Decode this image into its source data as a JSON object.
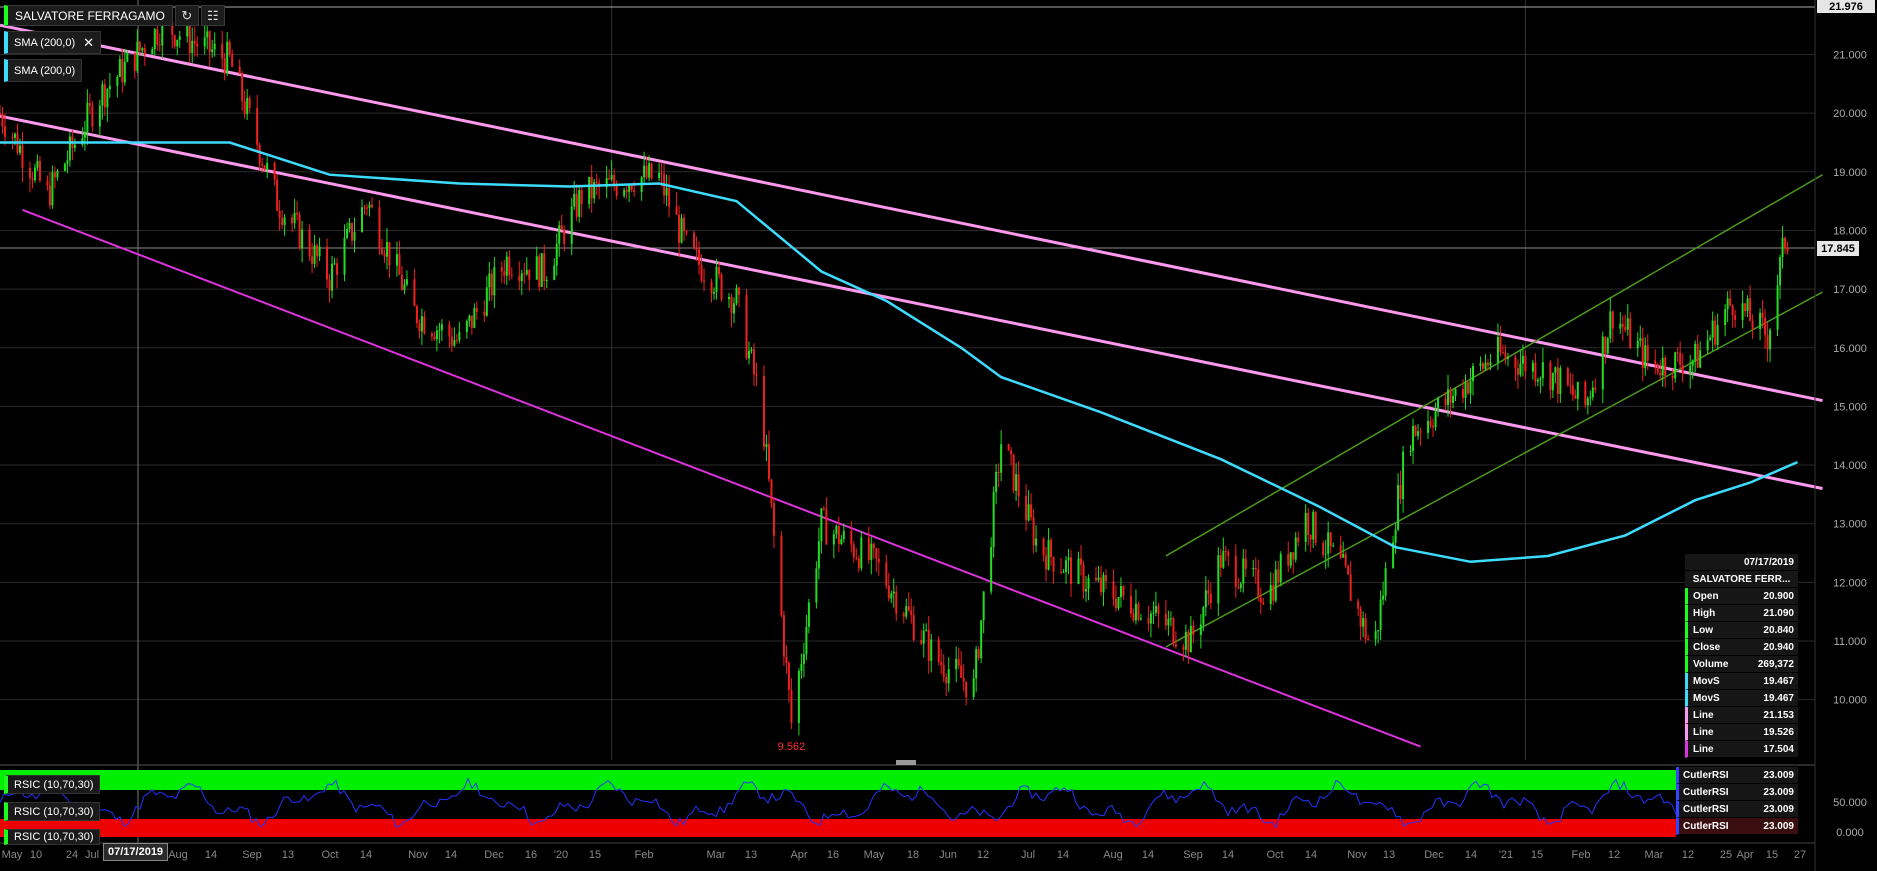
{
  "header": {
    "symbol": "SALVATORE FERRAGAMO",
    "refresh_icon": "refresh-icon",
    "settings_icon": "chart-settings-icon"
  },
  "indicators": [
    {
      "label": "SMA (200,0)",
      "color": "#3ddcff",
      "closable": true
    },
    {
      "label": "SMA (200,0)",
      "color": "#3ddcff",
      "closable": false
    }
  ],
  "rsi_labels": [
    "RSIC (10,70,30)",
    "RSIC (10,70,30)",
    "RSIC (10,70,30)"
  ],
  "price_axis": {
    "ticks": [
      "21.000",
      "20.000",
      "19.000",
      "18.000",
      "17.000",
      "16.000",
      "15.000",
      "14.000",
      "13.000",
      "12.000",
      "11.000",
      "10.000"
    ],
    "top_label": "21.976",
    "current_label": "17.845"
  },
  "rsi_axis": {
    "ticks": [
      "50.000",
      "0.000"
    ]
  },
  "low_marker": "9.562",
  "date_axis": {
    "labels": [
      "May",
      "10",
      "24",
      "Jul",
      "Aug",
      "14",
      "Sep",
      "13",
      "Oct",
      "14",
      "Nov",
      "14",
      "Dec",
      "16",
      "'20",
      "15",
      "Feb",
      "Mar",
      "13",
      "Apr",
      "16",
      "May",
      "18",
      "Jun",
      "12",
      "Jul",
      "14",
      "Aug",
      "14",
      "Sep",
      "14",
      "Oct",
      "14",
      "Nov",
      "13",
      "Dec",
      "14",
      "'21",
      "15",
      "Feb",
      "12",
      "Mar",
      "12",
      "25",
      "Apr",
      "15",
      "27"
    ],
    "cursor_date": "07/17/2019"
  },
  "data_window": {
    "date": "07/17/2019",
    "name": "SALVATORE FERR...",
    "rows": [
      {
        "label": "Open",
        "value": "20.900",
        "color": "#1aff1a"
      },
      {
        "label": "High",
        "value": "21.090",
        "color": "#1aff1a"
      },
      {
        "label": "Low",
        "value": "20.840",
        "color": "#1aff1a"
      },
      {
        "label": "Close",
        "value": "20.940",
        "color": "#1aff1a"
      },
      {
        "label": "Volume",
        "value": "269,372",
        "color": "#1aff1a"
      },
      {
        "label": "MovS",
        "value": "19.467",
        "color": "#3ddcff"
      },
      {
        "label": "MovS",
        "value": "19.467",
        "color": "#3ddcff"
      },
      {
        "label": "Line",
        "value": "21.153",
        "color": "#ff99ee"
      },
      {
        "label": "Line",
        "value": "19.526",
        "color": "#ff99ee"
      },
      {
        "label": "Line",
        "value": "17.504",
        "color": "#dd33dd"
      }
    ]
  },
  "rsi_window": {
    "rows": [
      {
        "label": "CutlerRSI",
        "value": "23.009"
      },
      {
        "label": "CutlerRSI",
        "value": "23.009"
      },
      {
        "label": "CutlerRSI",
        "value": "23.009"
      },
      {
        "label": "CutlerRSI",
        "value": "23.009"
      }
    ]
  },
  "colors": {
    "up": "#22dd22",
    "down": "#ee2020",
    "sma": "#3ddcff",
    "channel_upper": "#ff99ee",
    "channel_lower": "#dd33dd",
    "uptrend_channel": "#4a9a1a",
    "rsi_line": "#2233ff",
    "rsi_overbought_band": "#00ee00",
    "rsi_oversold_band": "#ee0000"
  },
  "chart_data": {
    "type": "candlestick",
    "title": "SALVATORE FERRAGAMO",
    "ylim": [
      9.3,
      21.976
    ],
    "last_price": 17.845,
    "low": 9.562,
    "price_path": [
      [
        "2019-05-01",
        20.0
      ],
      [
        "2019-05-20",
        18.6
      ],
      [
        "2019-06-10",
        20.3
      ],
      [
        "2019-07-05",
        21.5
      ],
      [
        "2019-08-01",
        20.9
      ],
      [
        "2019-08-20",
        18.5
      ],
      [
        "2019-09-10",
        17.2
      ],
      [
        "2019-09-25",
        18.5
      ],
      [
        "2019-10-14",
        16.6
      ],
      [
        "2019-11-01",
        16.1
      ],
      [
        "2019-11-20",
        17.5
      ],
      [
        "2019-12-05",
        17.3
      ],
      [
        "2019-12-20",
        18.6
      ],
      [
        "2020-01-10",
        18.9
      ],
      [
        "2020-01-20",
        18.9
      ],
      [
        "2020-02-01",
        17.6
      ],
      [
        "2020-02-20",
        16.8
      ],
      [
        "2020-03-01",
        15.0
      ],
      [
        "2020-03-13",
        9.6
      ],
      [
        "2020-03-25",
        13.0
      ],
      [
        "2020-04-16",
        12.3
      ],
      [
        "2020-05-10",
        10.7
      ],
      [
        "2020-05-25",
        10.2
      ],
      [
        "2020-06-05",
        14.4
      ],
      [
        "2020-06-20",
        12.6
      ],
      [
        "2020-07-10",
        12.0
      ],
      [
        "2020-07-30",
        11.6
      ],
      [
        "2020-08-20",
        11.0
      ],
      [
        "2020-09-01",
        12.4
      ],
      [
        "2020-09-20",
        11.8
      ],
      [
        "2020-10-05",
        13.1
      ],
      [
        "2020-10-20",
        12.2
      ],
      [
        "2020-11-01",
        10.8
      ],
      [
        "2020-11-15",
        14.5
      ],
      [
        "2020-12-01",
        15.1
      ],
      [
        "2020-12-20",
        15.9
      ],
      [
        "2021-01-10",
        15.6
      ],
      [
        "2021-01-25",
        15.0
      ],
      [
        "2021-02-05",
        16.6
      ],
      [
        "2021-02-20",
        15.7
      ],
      [
        "2021-03-10",
        15.8
      ],
      [
        "2021-03-25",
        16.8
      ],
      [
        "2021-04-08",
        16.2
      ],
      [
        "2021-04-15",
        17.845
      ]
    ],
    "sma_path": [
      [
        "2019-05-01",
        19.5
      ],
      [
        "2019-07-10",
        19.5
      ],
      [
        "2019-08-01",
        19.5
      ],
      [
        "2019-09-10",
        18.95
      ],
      [
        "2019-11-01",
        18.8
      ],
      [
        "2019-12-15",
        18.75
      ],
      [
        "2020-01-20",
        18.8
      ],
      [
        "2020-02-20",
        18.5
      ],
      [
        "2020-03-25",
        17.3
      ],
      [
        "2020-04-20",
        16.8
      ],
      [
        "2020-05-20",
        16.0
      ],
      [
        "2020-06-05",
        15.5
      ],
      [
        "2020-07-15",
        14.9
      ],
      [
        "2020-09-01",
        14.1
      ],
      [
        "2020-10-10",
        13.3
      ],
      [
        "2020-11-10",
        12.6
      ],
      [
        "2020-12-10",
        12.35
      ],
      [
        "2021-01-10",
        12.45
      ],
      [
        "2021-02-10",
        12.8
      ],
      [
        "2021-03-10",
        13.4
      ],
      [
        "2021-04-01",
        13.7
      ],
      [
        "2021-04-20",
        14.05
      ]
    ],
    "lines": [
      {
        "start": [
          "2019-05-01",
          21.5
        ],
        "end": [
          "2021-04-30",
          15.1
        ]
      },
      {
        "start": [
          "2019-05-01",
          19.95
        ],
        "end": [
          "2021-04-30",
          13.6
        ]
      },
      {
        "start": [
          "2019-05-10",
          18.35
        ],
        "end": [
          "2020-11-20",
          9.2
        ]
      },
      {
        "start": [
          "2020-08-10",
          12.45
        ],
        "end": [
          "2021-04-30",
          18.95
        ]
      },
      {
        "start": [
          "2020-08-10",
          10.9
        ],
        "end": [
          "2021-04-30",
          16.95
        ]
      }
    ],
    "rsi_ylim": [
      0,
      100
    ],
    "rsi_overbought": 70,
    "rsi_oversold": 30
  }
}
